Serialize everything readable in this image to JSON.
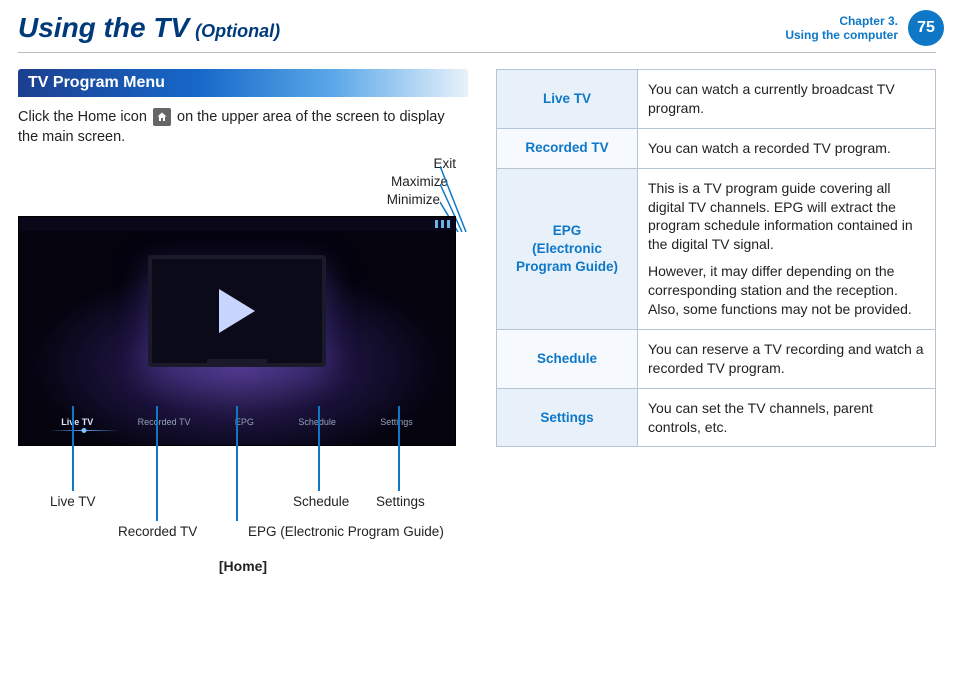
{
  "header": {
    "title": "Using the TV",
    "optional": "(Optional)",
    "chapter_line1": "Chapter 3.",
    "chapter_line2": "Using the computer",
    "page_no": "75"
  },
  "section": {
    "bar": "TV Program Menu",
    "intro_before": "Click the Home icon",
    "intro_after": "on the upper area of the screen to display the main screen.",
    "home_label": "[Home]"
  },
  "top_callouts": {
    "exit": "Exit",
    "maximize": "Maximize",
    "minimize": "Minimize"
  },
  "tabs": {
    "live": "Live TV",
    "recorded": "Recorded TV",
    "epg": "EPG",
    "schedule": "Schedule",
    "settings": "Settings"
  },
  "bottom_callouts": {
    "live": "Live TV",
    "recorded": "Recorded TV",
    "epg": "EPG (Electronic Program Guide)",
    "schedule": "Schedule",
    "settings": "Settings"
  },
  "table": {
    "r1": {
      "label": "Live TV",
      "desc": "You can watch a currently broadcast TV program."
    },
    "r2": {
      "label": "Recorded TV",
      "desc": "You can watch a recorded TV program."
    },
    "r3": {
      "label": "EPG\n(Electronic Program Guide)",
      "p1": "This is a TV program guide covering all digital TV channels. EPG will extract the program schedule information contained in the digital TV signal.",
      "p2": "However, it may differ depending on the corresponding station and the reception. Also, some functions may not be provided."
    },
    "r4": {
      "label": "Schedule",
      "desc": "You can reserve a TV recording and watch a recorded TV program."
    },
    "r5": {
      "label": "Settings",
      "desc": "You can set the TV channels, parent controls, etc."
    }
  }
}
